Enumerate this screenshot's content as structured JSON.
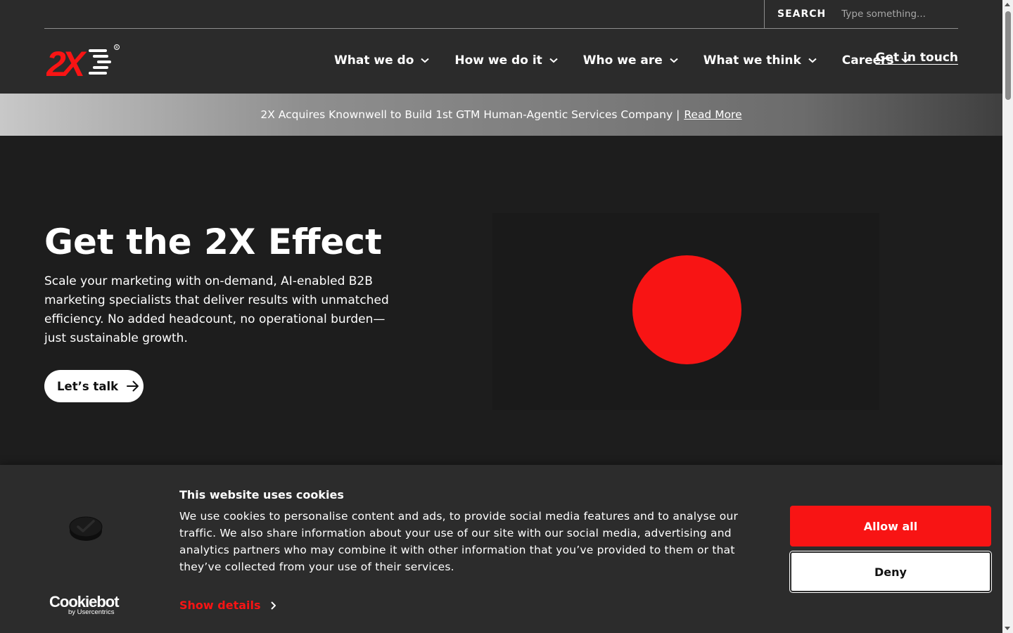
{
  "header": {
    "search_label": "SEARCH",
    "search_placeholder": "Type something...",
    "logo_text": "2X",
    "nav": [
      {
        "label": "What we do"
      },
      {
        "label": "How we do it"
      },
      {
        "label": "Who we are"
      },
      {
        "label": "What we think"
      },
      {
        "label": "Careers"
      }
    ],
    "contact_link": "Get in touch"
  },
  "announcement": {
    "text": "2X Acquires Knownwell to Build 1st GTM Human-Agentic Services Company |",
    "link": "Read More"
  },
  "hero": {
    "title": "Get the 2X Effect",
    "subtitle": "Scale your marketing with on-demand, AI-enabled B2B marketing specialists that deliver results with unmatched efficiency. No added headcount, no operational burden—just sustainable growth.",
    "cta_label": "Let’s talk"
  },
  "cookie_banner": {
    "title": "This website uses cookies",
    "body": "We use cookies to personalise content and ads, to provide social media features and to analyse our traffic. We also share information about your use of our site with our social media, advertising and analytics partners who may combine it with other information that you’ve provided to them or that they’ve collected from your use of their services.",
    "show_details": "Show details",
    "allow_all": "Allow all",
    "deny": "Deny",
    "brand": "Cookiebot",
    "brand_by": "by Usercentrics"
  },
  "colors": {
    "brand_red": "#f81414",
    "header_bg": "#2b2b2b",
    "hero_bg": "#1d1d1d",
    "cookie_bg": "#2c2c2c"
  },
  "icons": [
    "chevron-down-icon",
    "arrow-right-icon",
    "cookie-icon",
    "chevron-right-icon"
  ]
}
